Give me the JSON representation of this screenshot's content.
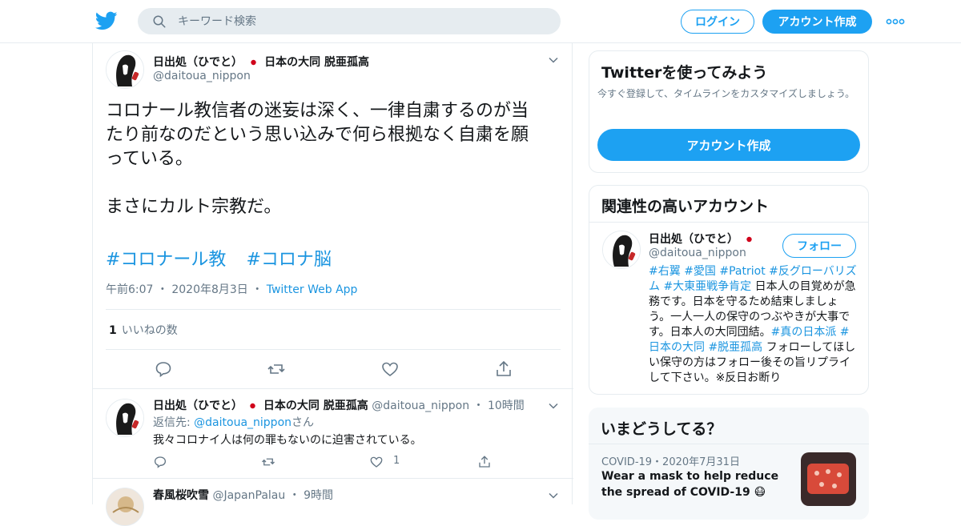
{
  "header": {
    "search_placeholder": "キーワード検索",
    "login_label": "ログイン",
    "signup_label": "アカウント作成",
    "brand_color": "#1DA1F2"
  },
  "main_tweet": {
    "name": "日出処（ひでと）",
    "name_suffix": "日本の大同 脱亜孤高",
    "handle": "@daitoua_nippon",
    "text": "コロナール教信者の迷妄は深く、一律自粛するのが当\nたり前なのだという思い込みで何ら根拠なく自粛を願\nっている。\n\nまさにカルト宗教だ。",
    "hashtags": [
      "#コロナール教",
      "#コロナ脳"
    ],
    "time": "午前6:07",
    "date": "2020年8月3日",
    "via": "Twitter Web App",
    "like_count": "1",
    "like_label": "いいねの数"
  },
  "reply_tweet": {
    "name": "日出処（ひでと）",
    "name_suffix": "日本の大同 脱亜孤高",
    "handle": "@daitoua_nippon",
    "time_ago": "10時間",
    "reply_prefix": "返信先: ",
    "reply_to": "@daitoua_nippon",
    "reply_suffix": "さん",
    "text": "我々コロナイ人は何の罪もないのに迫害されている。",
    "like_count": "1"
  },
  "third_tweet": {
    "name": "春風桜吹雪",
    "handle": "@JapanPalau",
    "time_ago": "9時間"
  },
  "sidebar": {
    "try_title": "Twitterを使ってみよう",
    "try_sub": "今すぐ登録して、タイムラインをカスタマイズしましょう。",
    "try_button": "アカウント作成",
    "related_title": "関連性の高いアカウント",
    "related": {
      "name": "日出処（ひでと）",
      "handle": "@daitoua_nippon",
      "follow_label": "フォロー",
      "bio_parts": [
        {
          "text": "#右翼",
          "ht": true
        },
        {
          "text": " ",
          "ht": false
        },
        {
          "text": "#愛国",
          "ht": true
        },
        {
          "text": " ",
          "ht": false
        },
        {
          "text": "#Patriot",
          "ht": true
        },
        {
          "text": " ",
          "ht": false
        },
        {
          "text": "#反グローバリズム",
          "ht": true
        },
        {
          "text": " ",
          "ht": false
        },
        {
          "text": "#大東亜戦争肯定",
          "ht": true
        },
        {
          "text": " 日本人の目覚めが急務です。日本を守るため結束しましょう。一人一人の保守のつぶやきが大事です。日本人の大同団結。",
          "ht": false
        },
        {
          "text": "#真の日本派",
          "ht": true
        },
        {
          "text": " ",
          "ht": false
        },
        {
          "text": "#日本の大同",
          "ht": true
        },
        {
          "text": " ",
          "ht": false
        },
        {
          "text": "#脱亜孤高",
          "ht": true
        },
        {
          "text": " フォローしてほしい保守の方はフォロー後その旨リプライして下さい。※反日お断り",
          "ht": false
        }
      ]
    },
    "trend_title": "いまどうしてる？",
    "trend_meta": "COVID-19・2020年7月31日",
    "trend_text": "Wear a mask to help reduce the spread of COVID-19 😷"
  }
}
